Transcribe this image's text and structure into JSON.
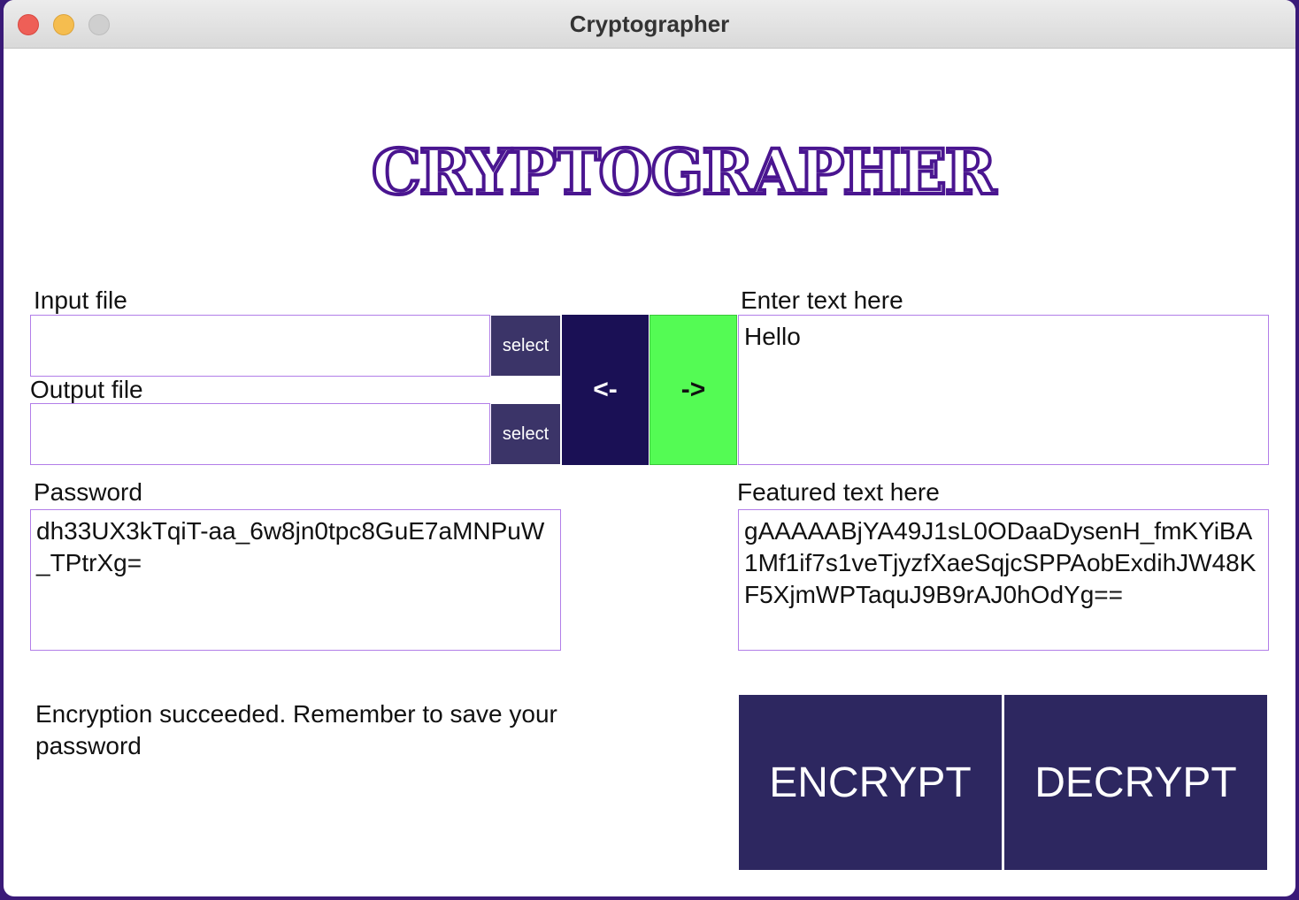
{
  "window": {
    "title": "Cryptographer"
  },
  "logo": {
    "text": "CRYPTOGRAPHER"
  },
  "input_file": {
    "label": "Input file",
    "value": "",
    "select_label": "select"
  },
  "output_file": {
    "label": "Output file",
    "value": "",
    "select_label": "select"
  },
  "direction": {
    "left_label": "<-",
    "right_label": "->"
  },
  "text_input": {
    "label": "Enter text here",
    "value": "Hello"
  },
  "password": {
    "label": "Password",
    "value": "dh33UX3kTqiT-aa_6w8jn0tpc8GuE7aMNPuW_TPtrXg="
  },
  "featured": {
    "label": "Featured text here",
    "value": "gAAAAABjYA49J1sL0ODaaDysenH_fmKYiBA1Mf1if7s1veTjyzfXaeSqjcSPPAobExdihJW48KF5XjmWPTaquJ9B9rAJ0hOdYg=="
  },
  "status": {
    "message": "Encryption succeeded. Remember to save your password"
  },
  "actions": {
    "encrypt_label": "ENCRYPT",
    "decrypt_label": "DECRYPT"
  },
  "colors": {
    "accent": "#2d2760",
    "select_button": "#3b3468",
    "direction_left": "#1a1055",
    "direction_right_active": "#54fb54",
    "field_border": "#b27ee8",
    "logo": "#4a1590"
  }
}
